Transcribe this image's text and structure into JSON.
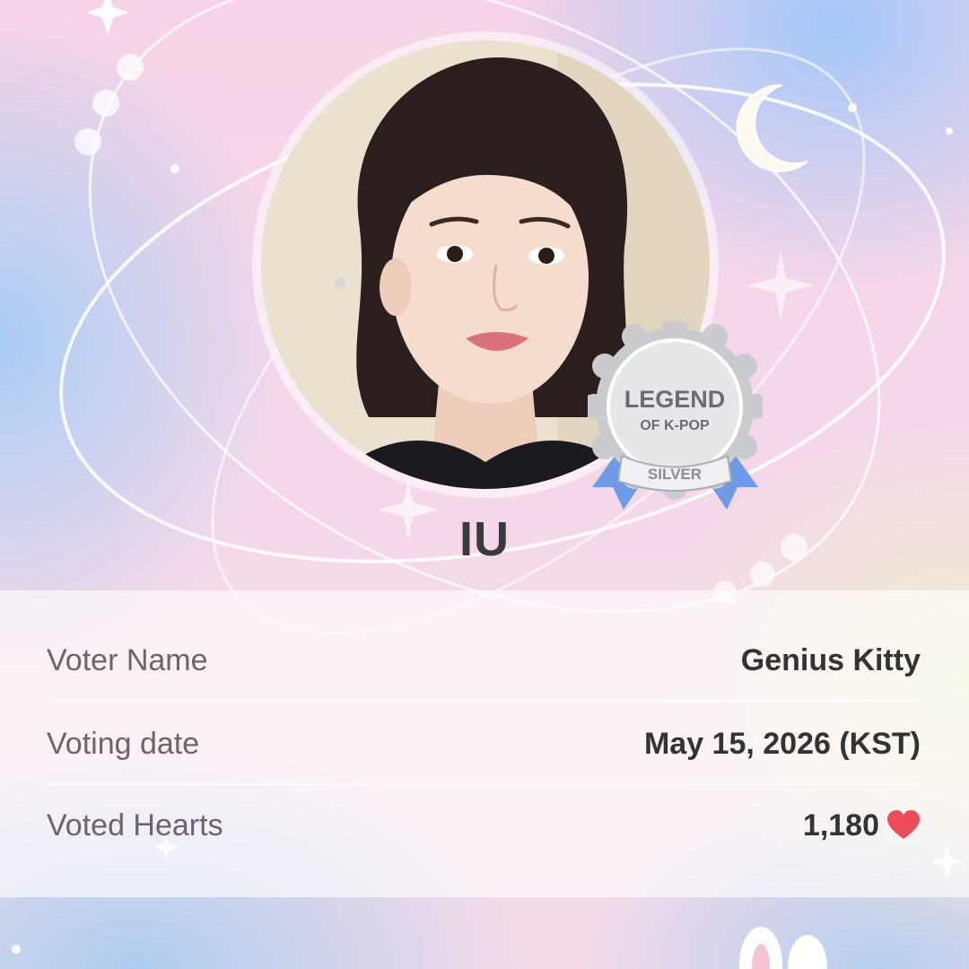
{
  "artist": {
    "name": "IU",
    "badge": {
      "line1": "LEGEND",
      "line2": "OF K-POP",
      "tier": "SILVER"
    }
  },
  "details": {
    "rows": [
      {
        "label": "Voter Name",
        "value": "Genius Kitty"
      },
      {
        "label": "Voting date",
        "value": "May 15, 2026 (KST)"
      },
      {
        "label": "Voted Hearts",
        "value": "1,180",
        "icon": "heart-icon"
      }
    ]
  },
  "colors": {
    "heart": "#ee4b58",
    "ribbon": "#6f9be6",
    "badge_silver": "#c9cbce"
  }
}
